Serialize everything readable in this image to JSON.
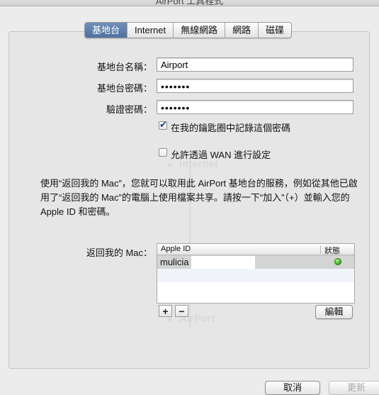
{
  "window": {
    "title": "AirPort 工具程式"
  },
  "tabs": [
    {
      "label": "基地台",
      "active": true
    },
    {
      "label": "Internet",
      "active": false
    },
    {
      "label": "無線網路",
      "active": false
    },
    {
      "label": "網路",
      "active": false
    },
    {
      "label": "磁碟",
      "active": false
    }
  ],
  "form": {
    "name_label": "基地台名稱：",
    "name_value": "Airport",
    "password_label": "基地台密碼：",
    "password_value": "•••••••",
    "verify_label": "驗證密碼：",
    "verify_value": "•••••••",
    "keychain_label": "在我的鑰匙圈中記錄這個密碼",
    "keychain_checked": true,
    "wan_label": "允許透過 WAN 進行設定",
    "wan_checked": false
  },
  "description": "使用“返回我的 Mac”，您就可以取用此 AirPort 基地台的服務，例如從其他已啟用了“返回我的 Mac”的電腦上使用檔案共享。請按一下“加入”（+）並輸入您的 Apple ID 和密碼。",
  "btmm": {
    "label": "返回我的 Mac：",
    "col_apple_id": "Apple ID",
    "col_status": "狀態",
    "rows": [
      {
        "apple_id": "mulicia",
        "status_color": "#3fb51d"
      }
    ],
    "add": "+",
    "remove": "−",
    "edit": "編輯"
  },
  "footer": {
    "cancel": "取消",
    "update": "更新"
  },
  "watermark": {
    "text1": "Internet",
    "text2": "AirPort"
  }
}
